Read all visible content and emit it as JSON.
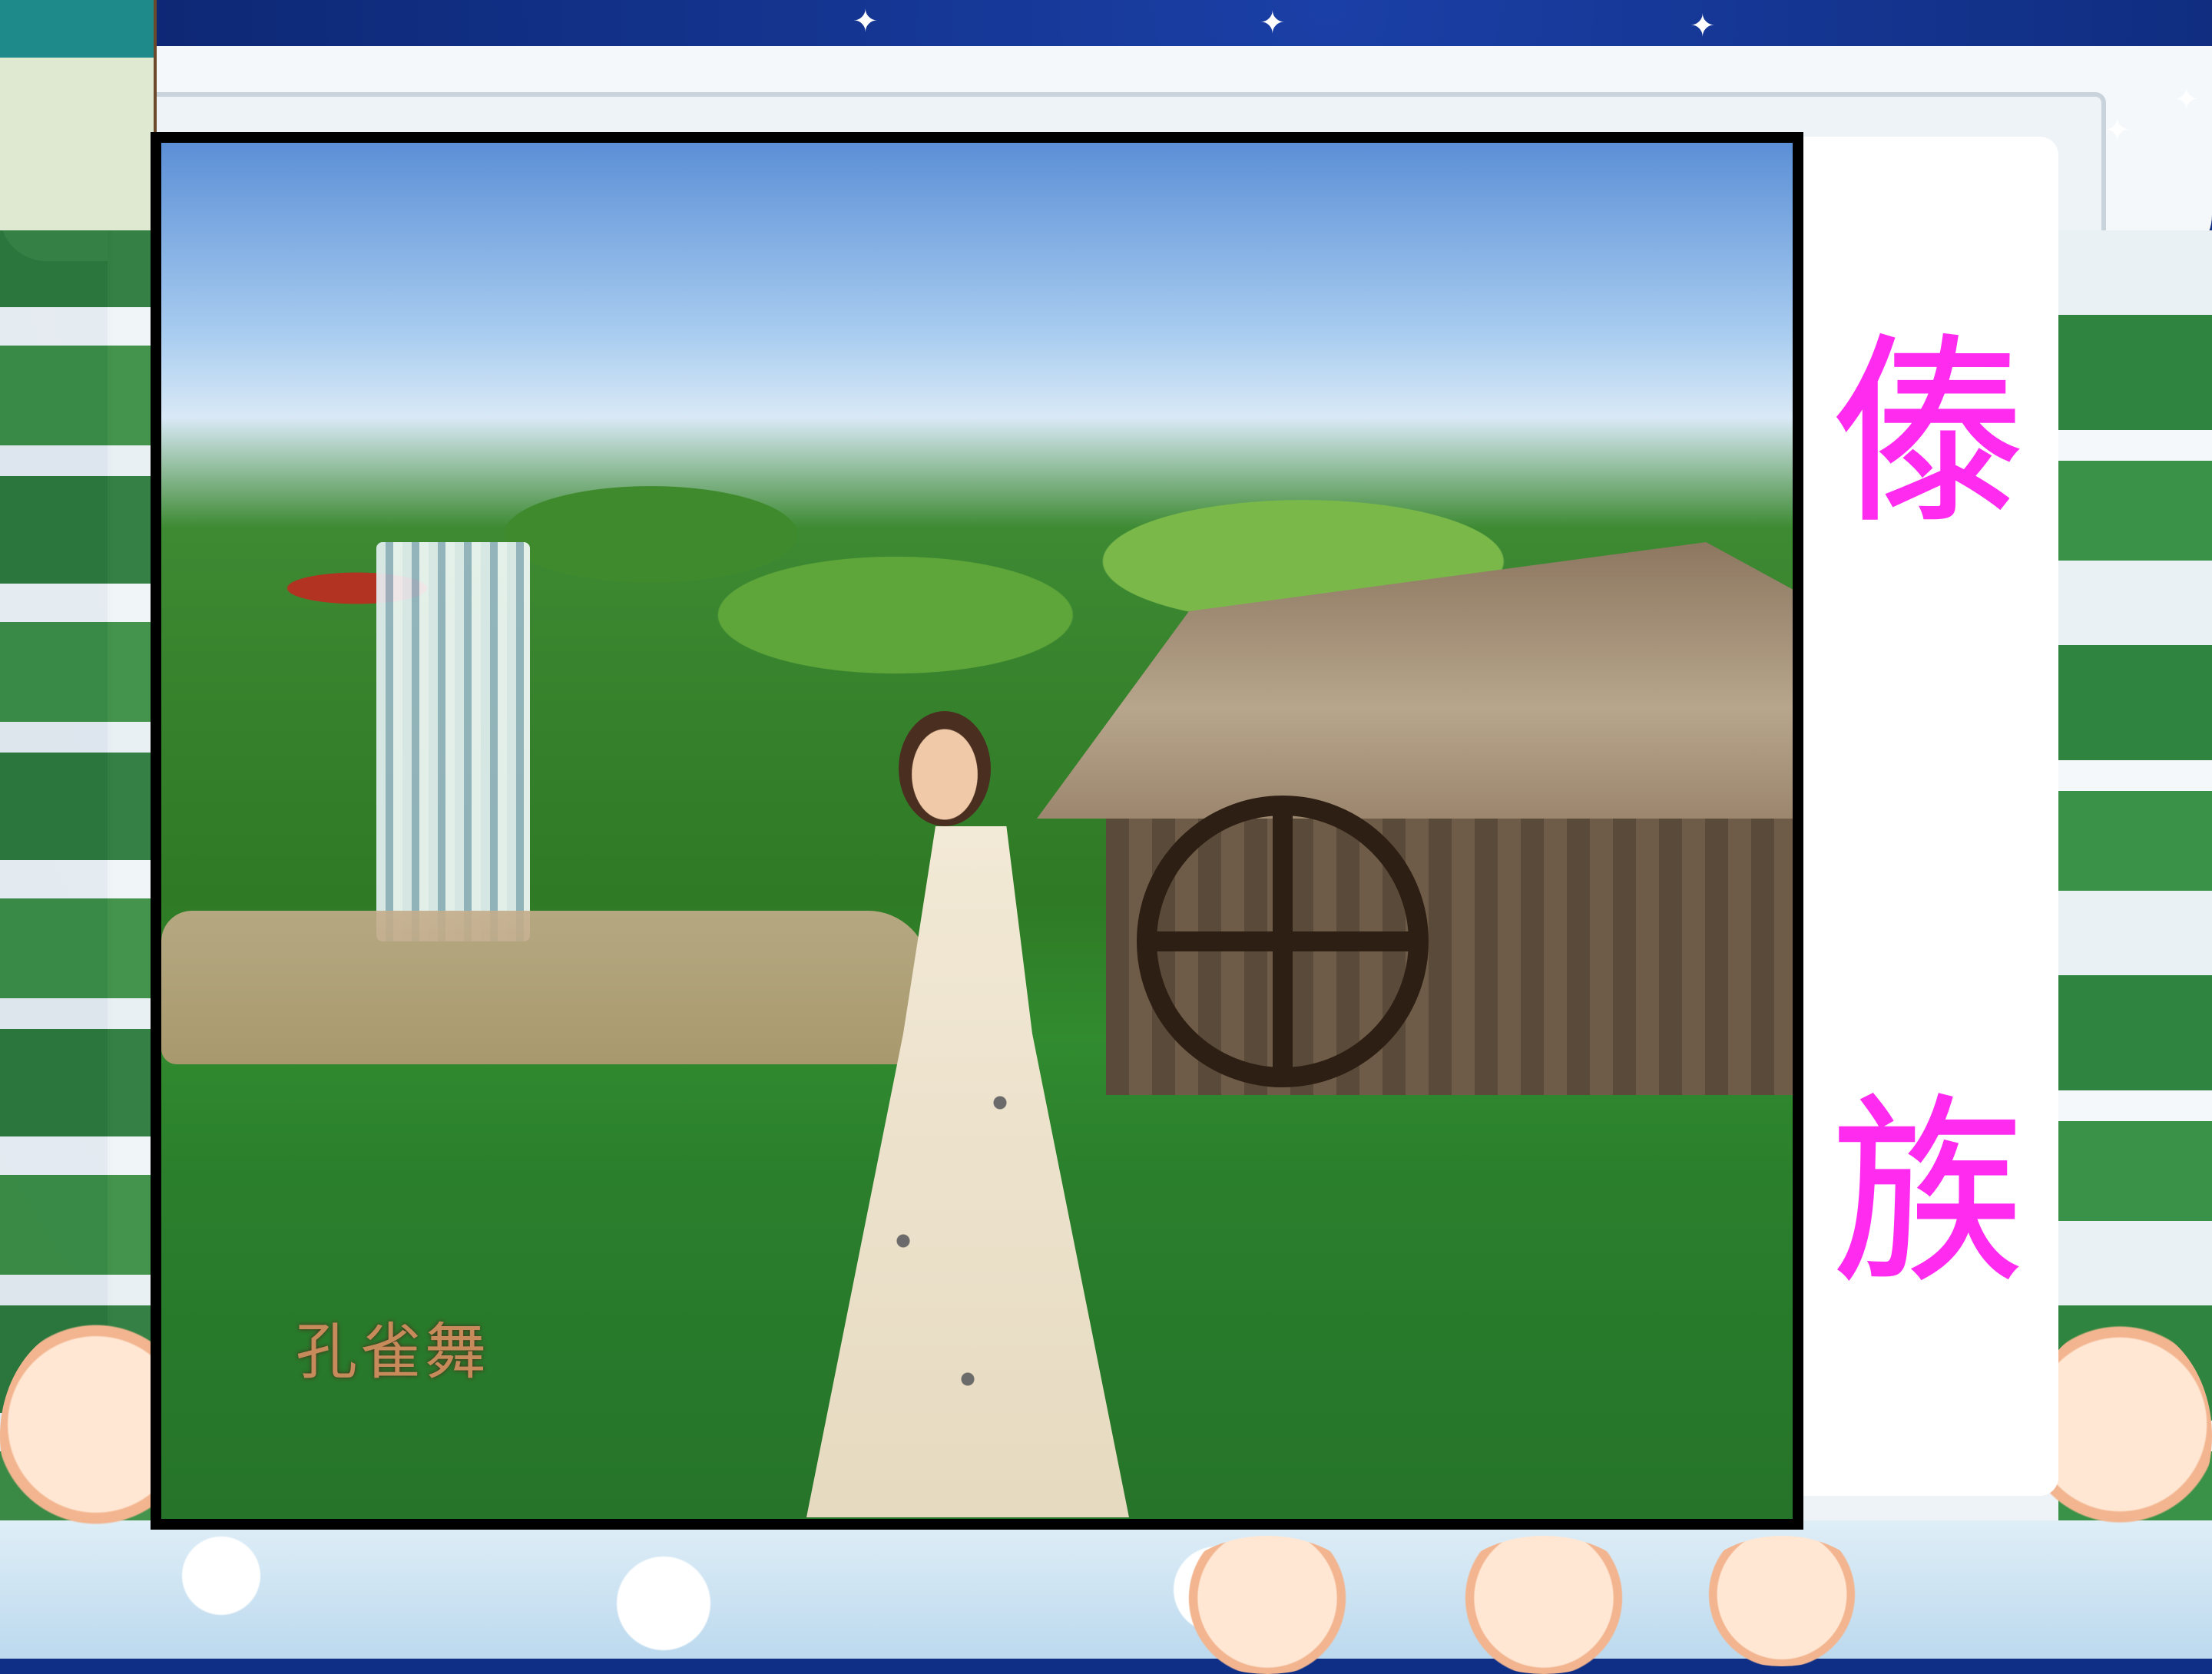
{
  "slide": {
    "title": "傣 族",
    "title_chars": [
      "傣",
      "族"
    ],
    "title_color": "#ff2cf0",
    "video": {
      "caption": "孔雀舞"
    }
  },
  "colors": {
    "sky_dark": "#0f2f86",
    "title_box": "#ffffff"
  },
  "icons": [
    "star-icon"
  ]
}
